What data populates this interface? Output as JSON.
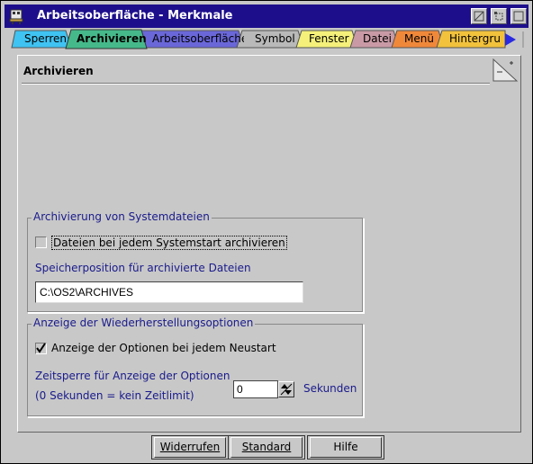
{
  "window": {
    "title": "Arbeitsoberfläche - Merkmale"
  },
  "tabs": [
    {
      "label": "Sperren",
      "color": "#3fc3f2"
    },
    {
      "label": "Archivieren",
      "color": "#46b98a"
    },
    {
      "label": "Arbeitsoberfläche",
      "color": "#6a67d9"
    },
    {
      "label": "Symbol",
      "color": "#b9b9b9"
    },
    {
      "label": "Fenster",
      "color": "#f4f07a"
    },
    {
      "label": "Datei",
      "color": "#c99aa6"
    },
    {
      "label": "Menü",
      "color": "#f0883a"
    },
    {
      "label": "Hintergrund",
      "color": "#f2c23c"
    }
  ],
  "page": {
    "title": "Archivieren"
  },
  "archive_group": {
    "label": "Archivierung von Systemdateien",
    "checkbox_label": "Dateien bei jedem Systemstart archivieren",
    "checked": false,
    "location_label": "Speicherposition für archivierte Dateien",
    "location_value": "C:\\OS2\\ARCHIVES"
  },
  "restore_group": {
    "label": "Anzeige der Wiederherstellungsoptionen",
    "checkbox_label": "Anzeige der Optionen bei jedem Neustart",
    "checked": true,
    "timeout_label_line1": "Zeitsperre für Anzeige der Optionen",
    "timeout_label_line2": "(0 Sekunden = kein Zeitlimit)",
    "timeout_value": "0",
    "timeout_unit": "Sekunden"
  },
  "buttons": {
    "undo": "Widerrufen",
    "default": "Standard",
    "help": "Hilfe"
  }
}
